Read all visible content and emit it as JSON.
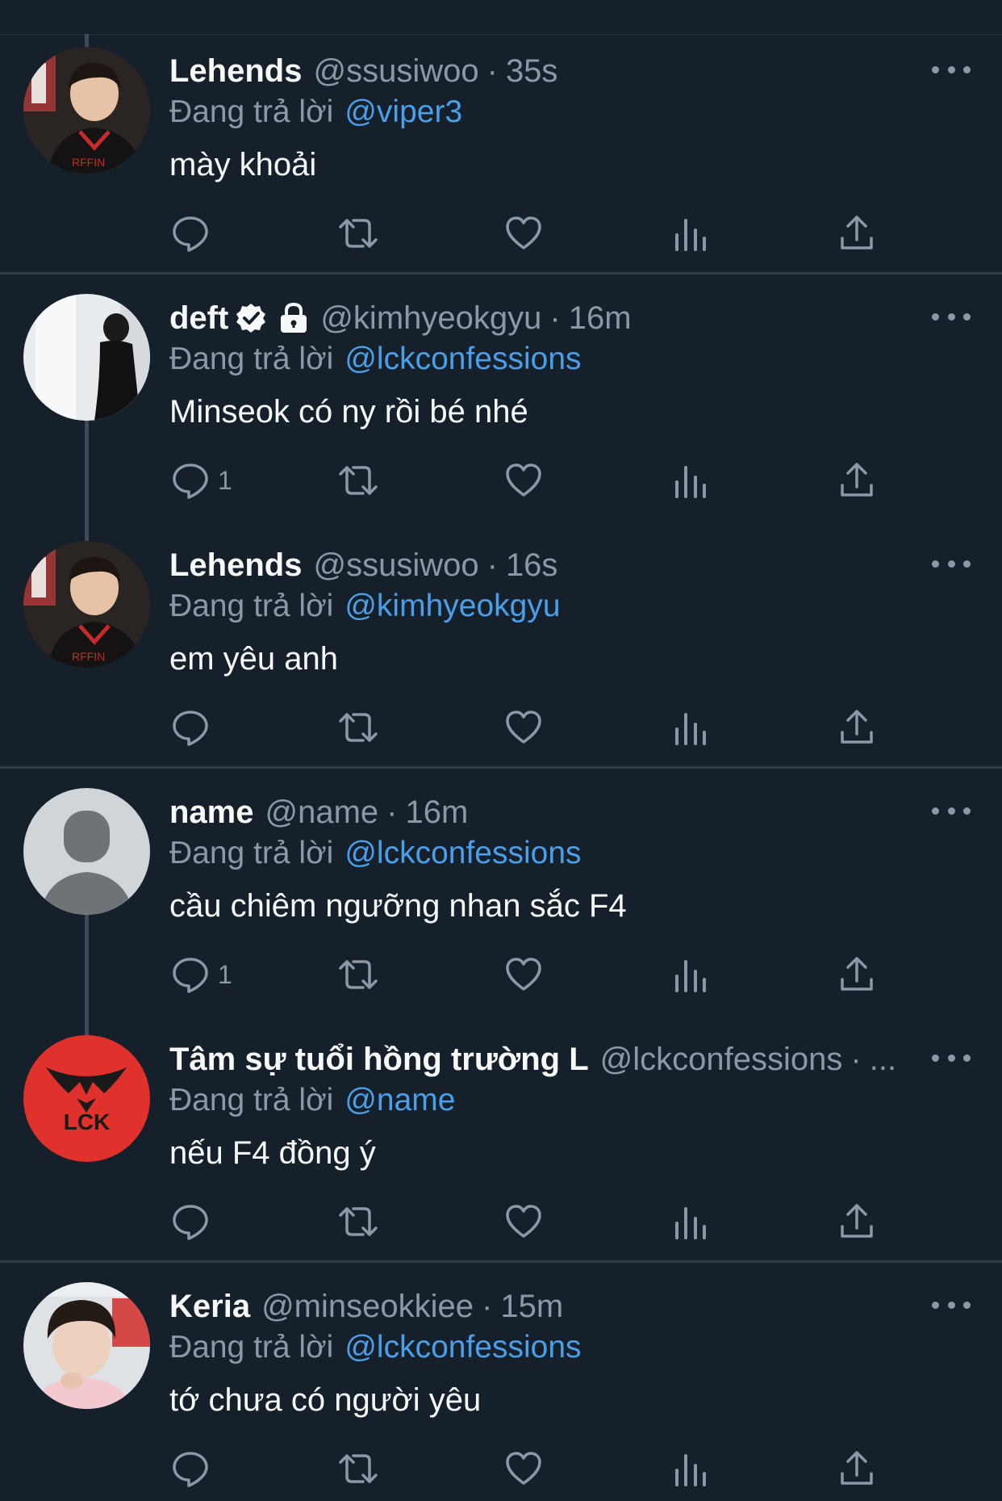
{
  "theme": {
    "background": "#15202b",
    "text_primary": "#f7f9f9",
    "text_secondary": "#8b98a5",
    "link": "#4a9fe8",
    "divider": "#2f3b47"
  },
  "reply_prefix": "Đang trả lời",
  "tweets": [
    {
      "display_name": "Lehends",
      "handle": "@ssusiwoo",
      "separator": "·",
      "time": "35s",
      "reply_to": "@viper3",
      "text": "mày khoải",
      "reply_count": "",
      "avatar": "player-photo"
    },
    {
      "display_name": "deft",
      "handle": "@kimhyeokgyu",
      "separator": "·",
      "time": "16m",
      "reply_to": "@lckconfessions",
      "text": "Minseok có ny rồi bé nhé",
      "reply_count": "1",
      "avatar": "profile-photo",
      "badges": [
        "verified-icon",
        "lock-icon"
      ]
    },
    {
      "display_name": "Lehends",
      "handle": "@ssusiwoo",
      "separator": "·",
      "time": "16s",
      "reply_to": "@kimhyeokgyu",
      "text": "em yêu anh",
      "reply_count": "",
      "avatar": "player-photo"
    },
    {
      "display_name": "name",
      "handle": "@name",
      "separator": "·",
      "time": "16m",
      "reply_to": "@lckconfessions",
      "text": "cầu chiêm ngưỡng nhan sắc F4",
      "reply_count": "1",
      "avatar": "default-avatar"
    },
    {
      "display_name": "Tâm sự tuổi hồng trường L",
      "handle": "@lckconfessions",
      "separator": "·",
      "time": "...",
      "reply_to": "@name",
      "text": "nếu F4 đồng ý",
      "reply_count": "",
      "avatar": "lck-logo",
      "avatar_color": "#e0312c",
      "logo_text": "LCK"
    },
    {
      "display_name": "Keria",
      "handle": "@minseokkiee",
      "separator": "·",
      "time": "15m",
      "reply_to": "@lckconfessions",
      "text": "tớ chưa có người yêu",
      "reply_count": "",
      "avatar": "profile-photo"
    }
  ],
  "actions": [
    "reply-icon",
    "retweet-icon",
    "like-icon",
    "views-icon",
    "share-icon"
  ]
}
